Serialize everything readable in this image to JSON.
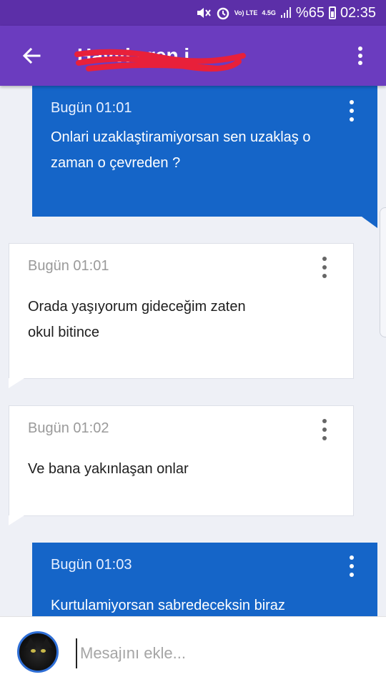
{
  "status_bar": {
    "volte_label": "Vo) LTE",
    "network_label": "4.5G",
    "battery_text": "%65",
    "time": "02:35"
  },
  "app_bar": {
    "title": "Havvi aren i",
    "back_icon": "arrow-left-icon",
    "menu_icon": "more-vertical-icon",
    "accent_color": "#6b3cbf"
  },
  "messages": [
    {
      "direction": "sent",
      "time": "Bugün 01:01",
      "lines": [
        "Onlari uzaklaştiramiyorsan sen uzaklaş o",
        "zaman o çevreden ?"
      ]
    },
    {
      "direction": "received",
      "time": "Bugün 01:01",
      "lines": [
        "Orada yaşıyorum gideceğim zaten",
        "okul bitince"
      ]
    },
    {
      "direction": "received",
      "time": "Bugün 01:02",
      "lines": [
        "Ve bana yakınlaşan onlar"
      ]
    },
    {
      "direction": "sent",
      "time": "Bugün 01:03",
      "lines": [
        "Kurtulamiyorsan sabredeceksin biraz"
      ]
    }
  ],
  "composer": {
    "placeholder": "Mesajını ekle...",
    "value": ""
  },
  "colors": {
    "sent_bubble": "#1565c8",
    "received_bubble": "#ffffff",
    "background": "#eef0f6"
  }
}
